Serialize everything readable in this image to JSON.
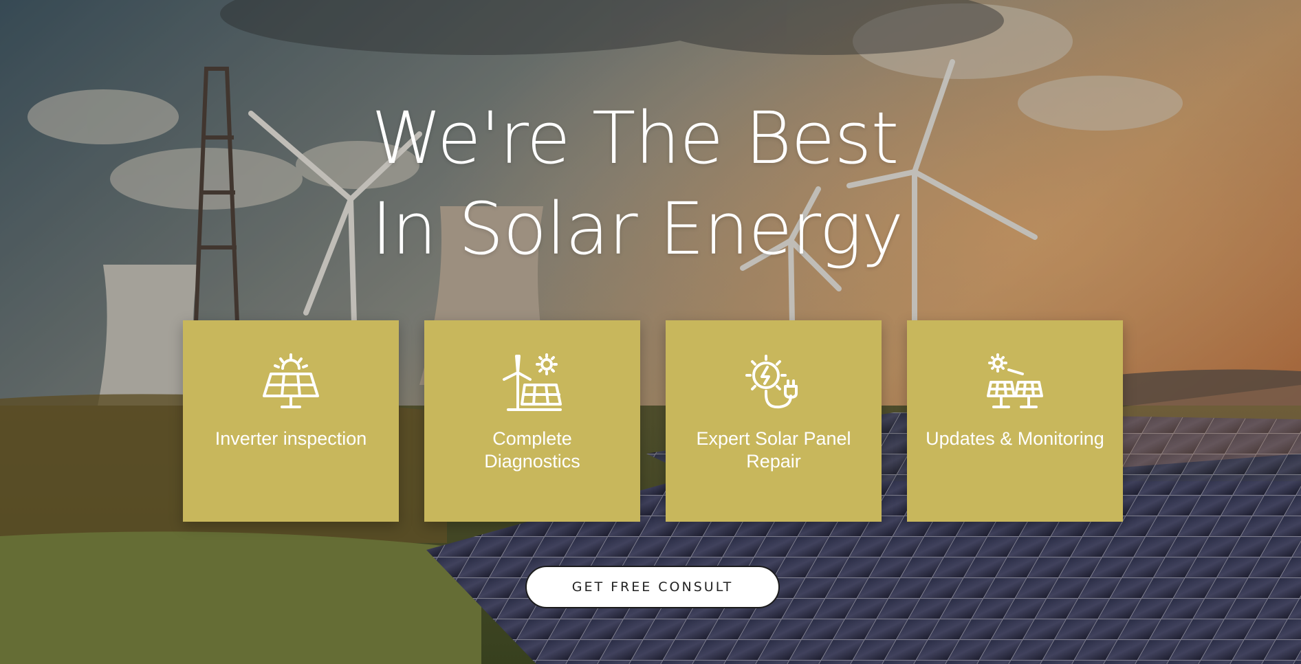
{
  "hero": {
    "headline_line1": "We're The Best",
    "headline_line2": "In Solar Energy",
    "text_color": "#ffffff"
  },
  "services": [
    {
      "title": "Inverter inspection",
      "icon": "solar-panel-sun-icon"
    },
    {
      "title": "Complete Diagnostics",
      "icon": "wind-solar-icon"
    },
    {
      "title": "Expert Solar Panel Repair",
      "icon": "sun-plug-icon"
    },
    {
      "title": "Updates & Monitoring",
      "icon": "solar-array-icon"
    }
  ],
  "card_color": "#c8b75c",
  "cta": {
    "label": "GET FREE CONSULT"
  }
}
